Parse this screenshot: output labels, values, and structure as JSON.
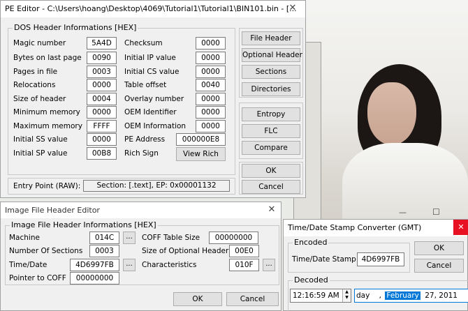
{
  "pe_editor": {
    "title": "PE Editor - C:\\Users\\hoang\\Desktop\\4069\\Tutorial1\\Tutorial1\\BIN101.bin - [...",
    "group_label": "DOS Header Informations [HEX]",
    "left_fields": [
      {
        "label": "Magic number",
        "value": "5A4D"
      },
      {
        "label": "Bytes on last page",
        "value": "0090"
      },
      {
        "label": "Pages in file",
        "value": "0003"
      },
      {
        "label": "Relocations",
        "value": "0000"
      },
      {
        "label": "Size of header",
        "value": "0004"
      },
      {
        "label": "Minimum memory",
        "value": "0000"
      },
      {
        "label": "Maximum memory",
        "value": "FFFF"
      },
      {
        "label": "Initial SS value",
        "value": "0000"
      },
      {
        "label": "Initial SP value",
        "value": "00B8"
      }
    ],
    "right_fields": [
      {
        "label": "Checksum",
        "value": "0000"
      },
      {
        "label": "Initial IP value",
        "value": "0000"
      },
      {
        "label": "Initial CS value",
        "value": "0000"
      },
      {
        "label": "Table offset",
        "value": "0040"
      },
      {
        "label": "Overlay number",
        "value": "0000"
      },
      {
        "label": "OEM Identifier",
        "value": "0000"
      },
      {
        "label": "OEM Information",
        "value": "0000"
      }
    ],
    "pe_address_label": "PE Address",
    "pe_address_value": "000000E8",
    "rich_sign_label": "Rich Sign",
    "view_rich": "View Rich",
    "entry_point_label": "Entry Point (RAW):",
    "entry_point_value": "Section: [.text], EP: 0x00001132",
    "side_buttons": [
      "File Header",
      "Optional Header",
      "Sections",
      "Directories",
      "Entropy",
      "FLC",
      "Compare"
    ],
    "ok": "OK",
    "cancel": "Cancel",
    "close_glyph": "✕"
  },
  "image_header": {
    "title": "Image File Header Editor",
    "group_label": "Image File Header Informations [HEX]",
    "machine_label": "Machine",
    "machine_value": "014C",
    "sections_label": "Number Of Sections",
    "sections_value": "0003",
    "timedate_label": "Time/Date",
    "timedate_value": "4D6997FB",
    "ptr_coff_label": "Pointer to COFF",
    "ptr_coff_value": "00000000",
    "coff_size_label": "COFF Table Size",
    "coff_size_value": "00000000",
    "opt_size_label": "Size of Optional Header",
    "opt_size_value": "00E0",
    "chars_label": "Characteristics",
    "chars_value": "010F",
    "dots": "...",
    "ok": "OK",
    "cancel": "Cancel",
    "close_glyph": "✕"
  },
  "timedate": {
    "title": "Time/Date Stamp Converter (GMT)",
    "encoded_label": "Encoded",
    "stamp_label": "Time/Date Stamp",
    "stamp_value": "4D6997FB",
    "decoded_label": "Decoded",
    "time_value": "12:16:59 AM",
    "date_day": "day",
    "date_comma": ",",
    "date_month": "February",
    "date_rest": "27, 2011",
    "ok": "OK",
    "cancel": "Cancel",
    "close_glyph": "✕"
  },
  "photo_window": {
    "minimize_glyph": "—",
    "maximize_glyph": "☐"
  }
}
